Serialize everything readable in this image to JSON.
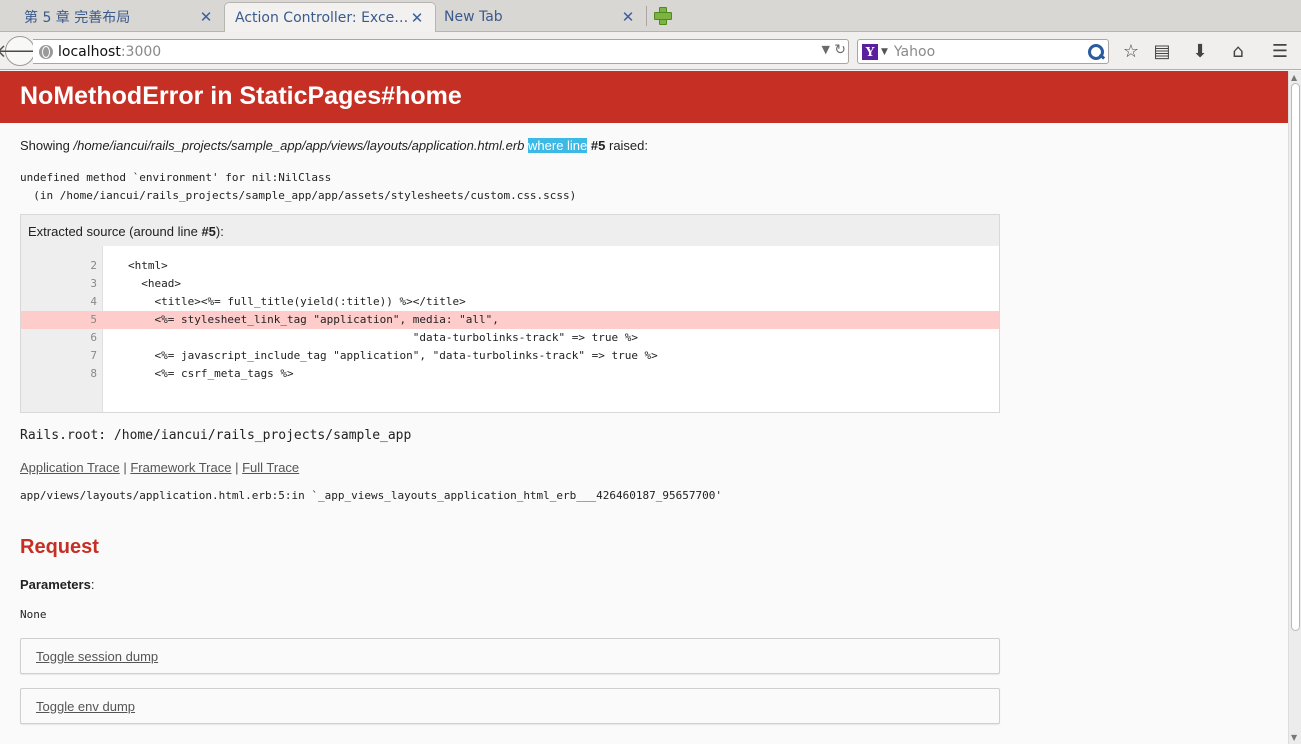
{
  "browser": {
    "tabs": [
      {
        "label": "第 5 章 完善布局",
        "active": false
      },
      {
        "label": "Action Controller: Exce…",
        "active": true
      },
      {
        "label": "New Tab",
        "active": false
      }
    ],
    "url_host": "localhost",
    "url_port": ":3000",
    "search_engine_letter": "Y",
    "search_placeholder": "Yahoo"
  },
  "error": {
    "title": "NoMethodError in StaticPages#home",
    "showing_prefix": "Showing ",
    "file_path": "/home/iancui/rails_projects/sample_app/app/views/layouts/application.html.erb",
    "where_line": "where line",
    "line_ref": "#5",
    "raised": " raised:",
    "message_line1": "undefined method `environment' for nil:NilClass",
    "message_line2": "  (in /home/iancui/rails_projects/sample_app/app/assets/stylesheets/custom.css.scss)"
  },
  "source": {
    "title_prefix": "Extracted source (around line ",
    "title_line": "#5",
    "title_suffix": "):",
    "lines": [
      {
        "num": "2",
        "code": "<html>"
      },
      {
        "num": "3",
        "code": "  <head>"
      },
      {
        "num": "4",
        "code": "    <title><%= full_title(yield(:title)) %></title>"
      },
      {
        "num": "5",
        "code": "    <%= stylesheet_link_tag \"application\", media: \"all\","
      },
      {
        "num": "6",
        "code": "                                           \"data-turbolinks-track\" => true %>"
      },
      {
        "num": "7",
        "code": "    <%= javascript_include_tag \"application\", \"data-turbolinks-track\" => true %>"
      },
      {
        "num": "8",
        "code": "    <%= csrf_meta_tags %>"
      }
    ]
  },
  "rails_root": "Rails.root: /home/iancui/rails_projects/sample_app",
  "traces": {
    "application": "Application Trace",
    "framework": "Framework Trace",
    "full": "Full Trace",
    "separator": " | ",
    "line": "app/views/layouts/application.html.erb:5:in `_app_views_layouts_application_html_erb___426460187_95657700'"
  },
  "request": {
    "title": "Request",
    "params_label": "Parameters",
    "params_colon": ":",
    "params_value": "None",
    "toggle_session": "Toggle session dump",
    "toggle_env": "Toggle env dump"
  }
}
